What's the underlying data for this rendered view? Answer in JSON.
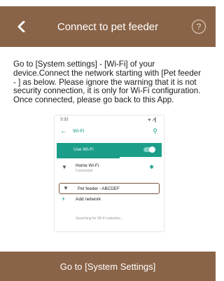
{
  "header": {
    "title": "Connect to pet feeder",
    "back_icon": "chevron-left-icon",
    "help_label": "?"
  },
  "instruction": "Go to [System settings] - [Wi-Fi] of your device.Connect the network starting with [Pet feeder - ] as below. Please ignore the warning that it is not security connection, it is only for Wi-Fi configuration. Once connected, please go back to this App.",
  "illustration": {
    "status_time": "3:32",
    "status_icons": "▼↗▎",
    "wifi_title": "Wi-Fi",
    "use_wifi_label": "Use Wi-Fi",
    "home_network": {
      "name": "Home Wi-Fi",
      "status": "Connected"
    },
    "pet_network": {
      "name": "Pet feeder - ABCDEF"
    },
    "add_network_label": "Add network",
    "searching_text": "Searching for Wi-Fi networks..."
  },
  "footer": {
    "button_label": "Go to [System Settings]"
  },
  "colors": {
    "brand_brown": "#8a6448",
    "wifi_teal": "#1a9e8a"
  }
}
